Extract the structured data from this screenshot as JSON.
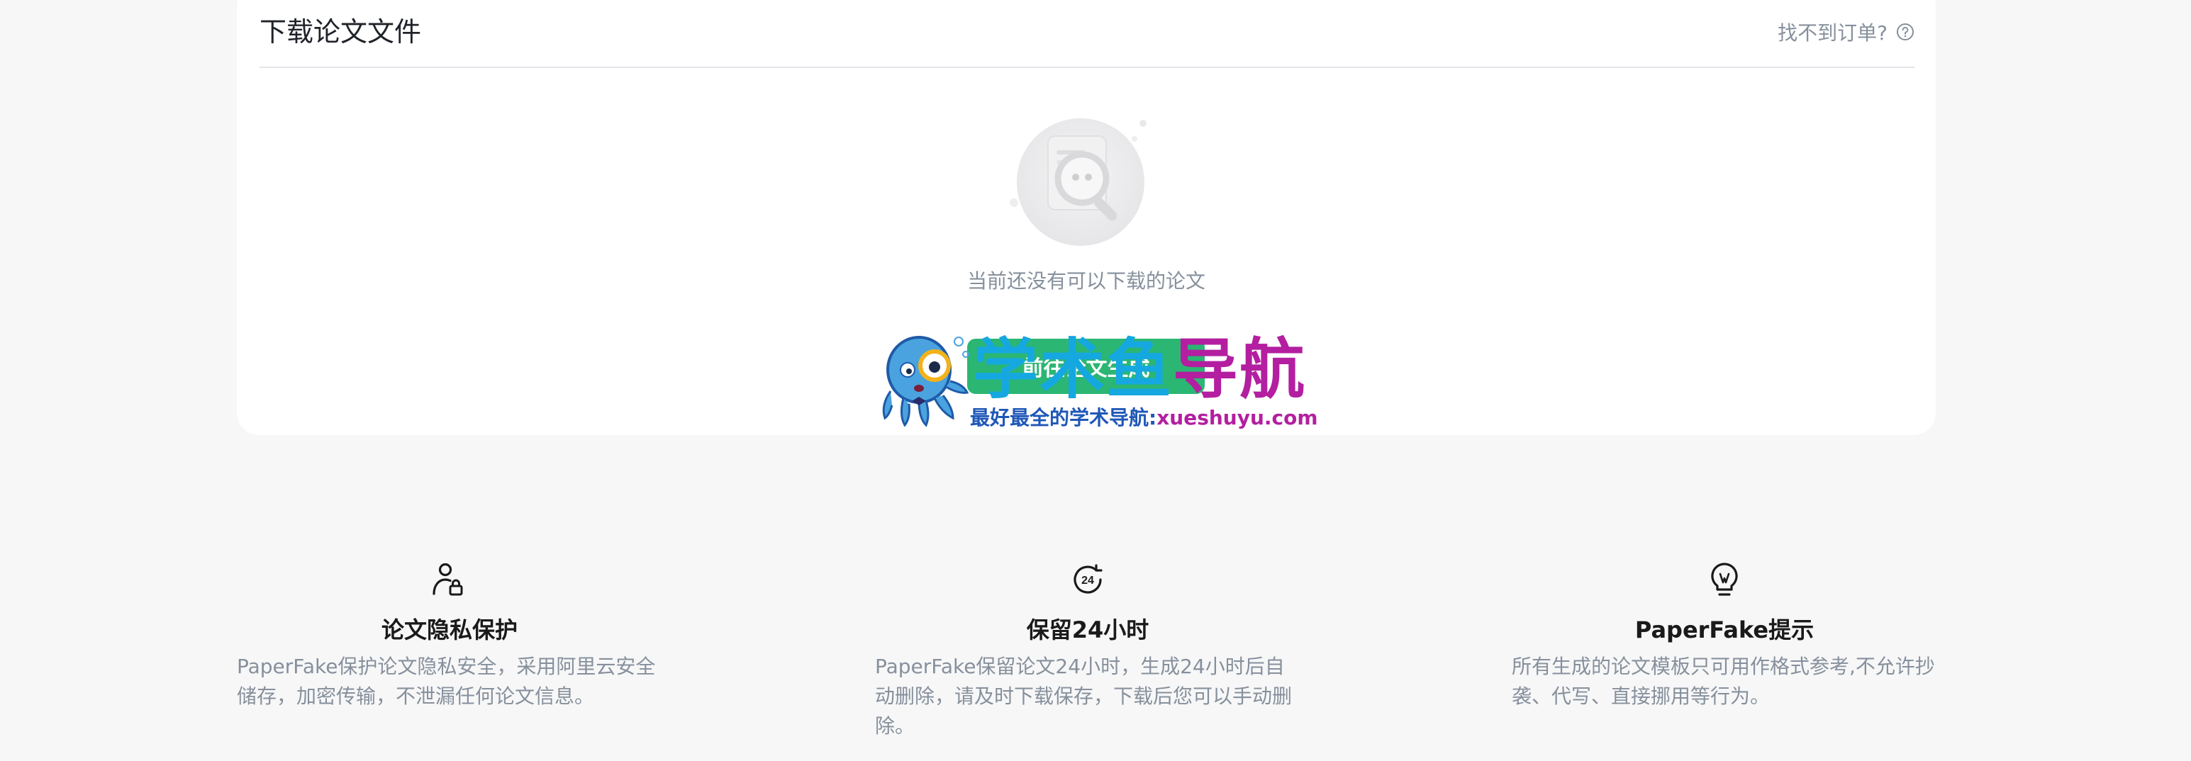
{
  "card": {
    "title": "下载论文文件",
    "help_link": "找不到订单?",
    "empty_message": "当前还没有可以下载的论文",
    "primary_button": "前往论文生成"
  },
  "watermark": {
    "title_part1": "学术鱼",
    "title_part2": "导航",
    "subtitle_part1": "最好最全的学术导航:",
    "subtitle_part2": "xueshuyu.com"
  },
  "features": [
    {
      "icon": "user-lock-icon",
      "title": "论文隐私保护",
      "desc": "PaperFake保护论文隐私安全，采用阿里云安全储存，加密传输，不泄漏任何论文信息。"
    },
    {
      "icon": "clock-24-icon",
      "title": "保留24小时",
      "desc": "PaperFake保留论文24小时，生成24小时后自动删除，请及时下载保存，下载后您可以手动删除。"
    },
    {
      "icon": "lightbulb-icon",
      "title": "PaperFake提示",
      "desc": "所有生成的论文模板只可用作格式参考,不允许抄袭、代写、直接挪用等行为。"
    }
  ],
  "colors": {
    "accent": "#2bb673",
    "muted_text": "#86909c",
    "background": "#f7f7f8",
    "watermark_blue": "#15a8e0",
    "watermark_magenta": "#b31fa0"
  }
}
